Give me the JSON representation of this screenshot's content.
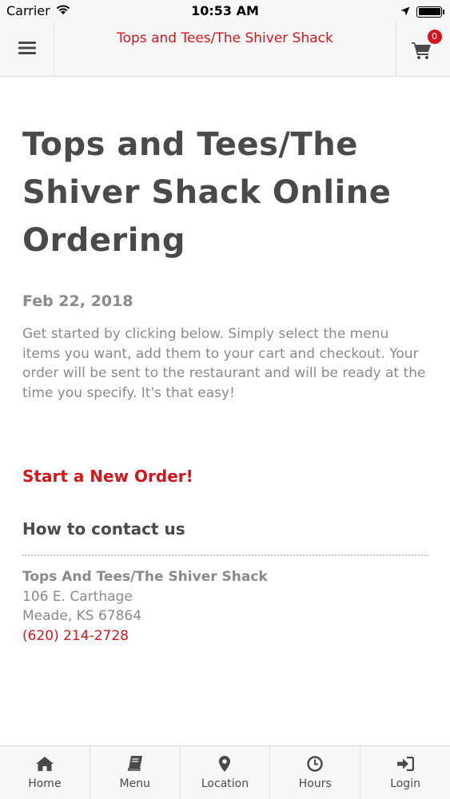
{
  "status_bar": {
    "carrier": "Carrier",
    "time": "10:53 AM"
  },
  "nav": {
    "title": "Tops and Tees/The Shiver Shack",
    "cart_count": "0"
  },
  "page": {
    "title": "Tops and Tees/The Shiver Shack Online Ordering",
    "date": "Feb 22, 2018",
    "intro": "Get started by clicking below. Simply select the menu items you want, add them to your cart and checkout. Your order will be sent to the restaurant and will be ready at the time you specify. It's that easy!",
    "start_order": "Start a New Order!",
    "contact_heading": "How to contact us",
    "contact": {
      "name": "Tops And Tees/The Shiver Shack",
      "address_line1": "106 E. Carthage",
      "address_line2": "Meade, KS 67864",
      "phone": "(620) 214-2728"
    }
  },
  "tabs": [
    {
      "label": "Home",
      "icon": "home-icon"
    },
    {
      "label": "Menu",
      "icon": "book-icon"
    },
    {
      "label": "Location",
      "icon": "map-marker-icon"
    },
    {
      "label": "Hours",
      "icon": "clock-icon"
    },
    {
      "label": "Login",
      "icon": "sign-in-icon"
    }
  ],
  "colors": {
    "accent": "#d3161b",
    "heading": "#4a4a4a",
    "muted": "#8a8a8a",
    "bar_bg": "#f7f7f7"
  }
}
